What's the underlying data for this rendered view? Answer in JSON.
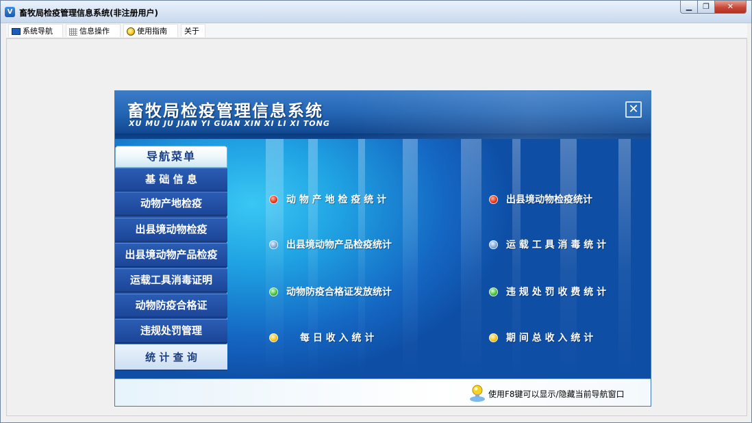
{
  "window": {
    "title": "畜牧局检疫管理信息系统(非注册用户)",
    "icon": "app-logo-icon",
    "controls": {
      "minimize": "minimize-icon",
      "maximize": "maximize-icon",
      "close": "close-icon"
    }
  },
  "menu": {
    "items": [
      {
        "label": "系统导航",
        "icon": "monitor-icon"
      },
      {
        "label": "信息操作",
        "icon": "grid-icon"
      },
      {
        "label": "使用指南",
        "icon": "lightbulb-icon"
      },
      {
        "label": "关于"
      }
    ]
  },
  "panel": {
    "title": "畜牧局检疫管理信息系统",
    "subtitle": "XU MU JU JIAN YI GUAN  XIN XI LI XI TONG",
    "close_symbol": "✕",
    "sidebar": {
      "header": "导航菜单",
      "items": [
        {
          "label": "基 础 信 息"
        },
        {
          "label": "动物产地检疫"
        },
        {
          "label": "出县境动物检疫"
        },
        {
          "label": "出县境动物产品检疫"
        },
        {
          "label": "运载工具消毒证明"
        },
        {
          "label": "动物防疫合格证"
        },
        {
          "label": "违规处罚管理"
        },
        {
          "label": "统 计 查 询",
          "selected": true
        }
      ]
    },
    "stats": {
      "left": [
        {
          "label": "动 物 产 地 检 疫 统 计",
          "dot": "red"
        },
        {
          "label": "出县境动物产品检疫统计",
          "dot": "blue"
        },
        {
          "label": "动物防疫合格证发放统计",
          "dot": "green"
        },
        {
          "label": "每 日 收 入 统 计",
          "dot": "yellow"
        }
      ],
      "right": [
        {
          "label": "出县境动物检疫统计",
          "dot": "red"
        },
        {
          "label": "运 载 工 具 消 毒 统 计",
          "dot": "blue"
        },
        {
          "label": "违 规 处 罚 收 费 统 计",
          "dot": "green"
        },
        {
          "label": "期 间 总 收 入 统 计",
          "dot": "yellow"
        }
      ]
    },
    "footer_hint": "使用F8键可以显示/隐藏当前导航窗口"
  },
  "colors": {
    "title_gradient_top": "#e9f1fb",
    "banner": "#2466b4",
    "content_light": "#39c7f4",
    "sidebar": "#1e4da0",
    "selected_item": "#cddff3"
  }
}
